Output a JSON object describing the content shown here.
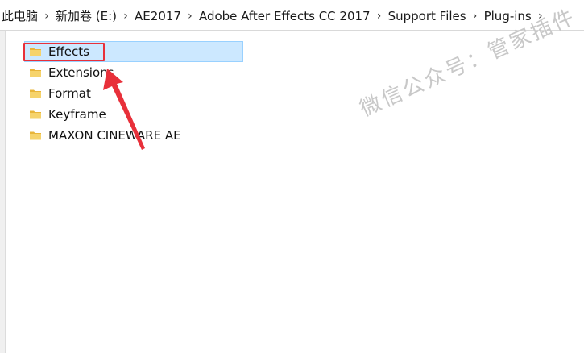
{
  "breadcrumb": {
    "items": [
      "此电脑",
      "新加卷 (E:)",
      "AE2017",
      "Adobe After Effects CC 2017",
      "Support Files",
      "Plug-ins"
    ]
  },
  "files": [
    {
      "name": "Effects",
      "selected": true
    },
    {
      "name": "Extensions",
      "selected": false
    },
    {
      "name": "Format",
      "selected": false
    },
    {
      "name": "Keyframe",
      "selected": false
    },
    {
      "name": "MAXON CINEWARE AE",
      "selected": false
    }
  ],
  "watermark": {
    "text": "微信公众号：管家插件"
  },
  "icons": {
    "folder": "folder-icon",
    "separator": "chevron-right-icon"
  },
  "colors": {
    "selection_bg": "#cce8ff",
    "selection_border": "#99d1ff",
    "annotation_red": "#e8303a",
    "folder_yellow": "#f4c542"
  }
}
